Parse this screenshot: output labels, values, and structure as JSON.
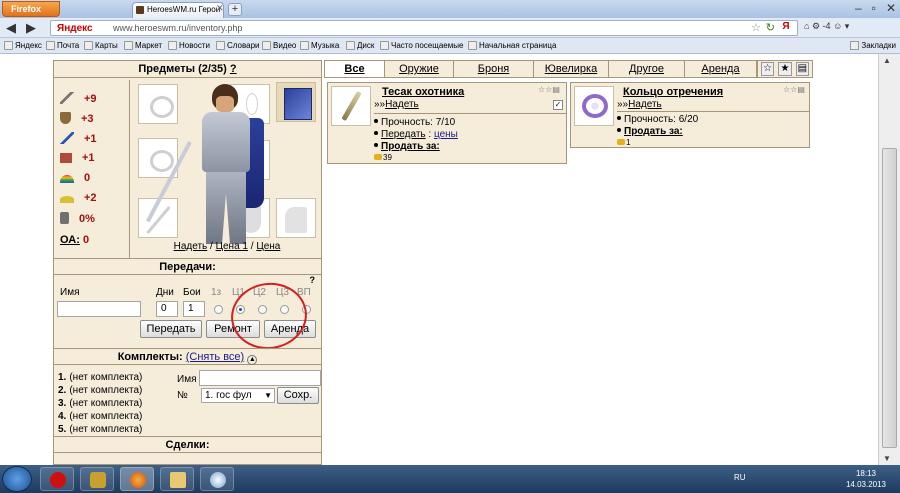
{
  "browser": {
    "firefox_label": "Firefox",
    "tab_title": "HeroesWM.ru Герои войны и денег. Он...",
    "url_logo": "Яндекс",
    "url": "www.heroeswm.ru/inventory.php",
    "nav_right": "-4",
    "bookmarks": [
      "Яндекс",
      "Почта",
      "Карты",
      "Маркет",
      "Новости",
      "Словари",
      "Видео",
      "Музыка",
      "Диск",
      "Часто посещаемые",
      "Начальная страница"
    ],
    "bookmarks_right": "Закладки"
  },
  "left": {
    "items_header": "Предметы (2/35)",
    "items_help": "?",
    "stats": [
      "+9",
      "+3",
      "+1",
      "+1",
      "0",
      "+2",
      "0%"
    ],
    "oa_label": "ОА:",
    "oa_value": "0",
    "doll_links": [
      "Надеть",
      "Цена 1",
      "Цена"
    ],
    "transfers_header": "Передачи:",
    "transfers_help": "?",
    "name_label": "Имя",
    "days_label": "Дни",
    "fights_label": "Бои",
    "days_value": "0",
    "fights_value": "1",
    "radio_labels": [
      "1з",
      "Ц1",
      "Ц2",
      "Ц3",
      "ВП"
    ],
    "btn_transfer": "Передать",
    "btn_repair": "Ремонт",
    "btn_rent": "Аренда",
    "kits_header": "Комплекты:",
    "kits_remove": "(Снять все)",
    "kits": [
      {
        "n": "1.",
        "t": "(нет комплекта)"
      },
      {
        "n": "2.",
        "t": "(нет комплекта)"
      },
      {
        "n": "3.",
        "t": "(нет комплекта)"
      },
      {
        "n": "4.",
        "t": "(нет комплекта)"
      },
      {
        "n": "5.",
        "t": "(нет комплекта)"
      }
    ],
    "kit_name_label": "Имя",
    "kit_no_label": "№",
    "kit_select": "1. гос фул",
    "kit_save": "Сохр.",
    "deals_header": "Сделки:"
  },
  "tabs": [
    "Все",
    "Оружие",
    "Броня",
    "Ювелирка",
    "Другое",
    "Аренда"
  ],
  "items": [
    {
      "title": "Тесак охотника",
      "wear": "Надеть",
      "durability": "Прочность: 7/10",
      "transfer": "Передать",
      "prices": "цены",
      "sell": "Продать за:",
      "gold": "39"
    },
    {
      "title": "Кольцо отречения",
      "wear": "Надеть",
      "durability": "Прочность: 6/20",
      "sell": "Продать за:",
      "gold": "1"
    }
  ],
  "taskbar": {
    "lang": "RU",
    "time": "18:13",
    "date": "14.03.2013"
  }
}
